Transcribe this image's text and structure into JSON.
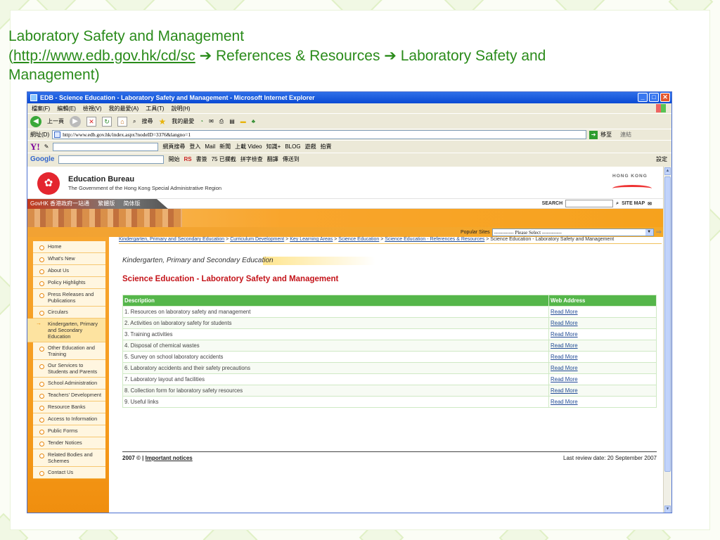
{
  "slide": {
    "title_line1": "Laboratory Safety and Management",
    "title_paren_open": "(",
    "title_url": "http://www.edb.gov.hk/cd/sc",
    "title_rest": "  ➔ References & Resources ➔ Laboratory Safety and Management)"
  },
  "browser": {
    "title": "EDB - Science Education - Laboratory Safety and Management - Microsoft Internet Explorer",
    "menu": [
      "檔案(F)",
      "編輯(E)",
      "檢視(V)",
      "我的最愛(A)",
      "工具(T)",
      "說明(H)"
    ],
    "toolbar": {
      "back": "上一頁",
      "search": "搜尋",
      "favorites": "我的最愛"
    },
    "address_label": "網址(D)",
    "address": "http://www.edb.gov.hk/index.aspx?nodeID=3376&langno=1",
    "go_label": "移至",
    "links_label": "連結",
    "yahoo_items": [
      "網頁搜尋",
      "登入",
      "Mail",
      "新聞",
      "上載 Video",
      "知識+",
      "BLOG",
      "遊戲",
      "拍賣"
    ],
    "google_items": [
      "開始",
      "RS",
      "書簽",
      "75 已攔截",
      "拼字檢查",
      "翻譯",
      "傳送到",
      "設定"
    ]
  },
  "edb": {
    "name": "Education Bureau",
    "sub": "The Government of the Hong Kong Special Administrative Region",
    "hk_logo": "HONG KONG",
    "gov_links": [
      "GovHK 香港政府一站通",
      "繁體版",
      "简体版"
    ],
    "search_label": "SEARCH",
    "sitemap": "SITE MAP",
    "popular_label": "Popular Sites",
    "popular_value": "------------ Please Select ------------"
  },
  "nav": [
    "Home",
    "What's New",
    "About Us",
    "Policy Highlights",
    "Press Releases and Publications",
    "Circulars",
    "Kindergarten, Primary and Secondary Education",
    "Other Education and Training",
    "Our Services to Students and Parents",
    "School Administration",
    "Teachers' Development",
    "Resource Banks",
    "Access to Information",
    "Public Forms",
    "Tender Notices",
    "Related Bodies and Schemes",
    "Contact Us"
  ],
  "breadcrumb": {
    "links": [
      "Kindergarten, Primary and Secondary Education",
      "Curriculum Development",
      "Key Learning Areas",
      "Science Education",
      "Science Education - References & Resources"
    ],
    "current": "Science Education - Laboratory Safety and Management"
  },
  "content": {
    "section_head": "Kindergarten, Primary and Secondary Education",
    "page_title": "Science Education - Laboratory Safety and Management",
    "table_headers": [
      "Description",
      "Web Address"
    ],
    "rows": [
      {
        "desc": "1. Resources on laboratory safety and management",
        "link": "Read More"
      },
      {
        "desc": "2. Activities on laboratory safety for students",
        "link": "Read More"
      },
      {
        "desc": "3. Training activities",
        "link": "Read More"
      },
      {
        "desc": "4. Disposal of chemical wastes",
        "link": "Read More"
      },
      {
        "desc": "5. Survey on school laboratory accidents",
        "link": "Read More"
      },
      {
        "desc": "6. Laboratory accidents and their safety precautions",
        "link": "Read More"
      },
      {
        "desc": "7. Laboratory layout and facilities",
        "link": "Read More"
      },
      {
        "desc": "8. Collection form for laboratory safety resources",
        "link": "Read More"
      },
      {
        "desc": "9. Useful links",
        "link": "Read More"
      }
    ]
  },
  "footer": {
    "copyright": "2007 © |",
    "important": "Important notices",
    "review": "Last review date: 20 September 2007"
  }
}
